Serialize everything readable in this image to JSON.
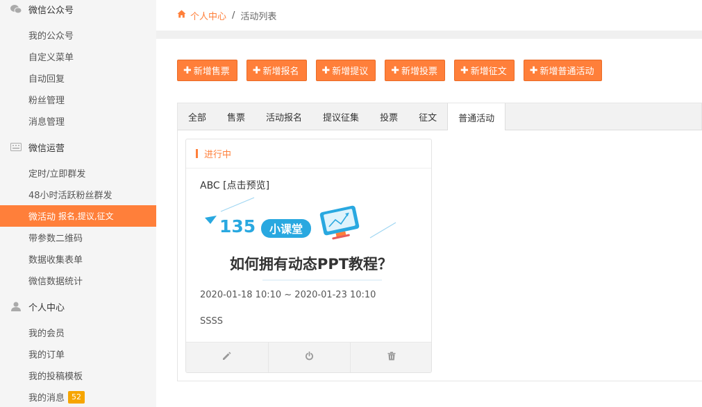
{
  "sidebar": {
    "groups": [
      {
        "title": "微信公众号",
        "icon": "wechat-icon",
        "items": [
          {
            "label": "我的公众号"
          },
          {
            "label": "自定义菜单"
          },
          {
            "label": "自动回复"
          },
          {
            "label": "粉丝管理"
          },
          {
            "label": "消息管理"
          }
        ]
      },
      {
        "title": "微信运营",
        "icon": "keyboard-icon",
        "items": [
          {
            "label": "定时/立即群发"
          },
          {
            "label": "48小时活跃粉丝群发"
          },
          {
            "label": "微活动",
            "sub": "报名,提议,征文",
            "active": true
          },
          {
            "label": "带参数二维码"
          },
          {
            "label": "数据收集表单"
          },
          {
            "label": "微信数据统计"
          }
        ]
      },
      {
        "title": "个人中心",
        "icon": "user-icon",
        "items": [
          {
            "label": "我的会员"
          },
          {
            "label": "我的订单"
          },
          {
            "label": "我的投稿模板"
          },
          {
            "label": "我的消息",
            "badge": "52"
          }
        ]
      }
    ]
  },
  "breadcrumb": {
    "home_label": "个人中心",
    "separator": "/",
    "current": "活动列表"
  },
  "actions": [
    "新增售票",
    "新增报名",
    "新增提议",
    "新增投票",
    "新增征文",
    "新增普通活动"
  ],
  "tabs": [
    {
      "label": "全部"
    },
    {
      "label": "售票"
    },
    {
      "label": "活动报名"
    },
    {
      "label": "提议征集"
    },
    {
      "label": "投票"
    },
    {
      "label": "征文"
    },
    {
      "label": "普通活动",
      "active": true
    }
  ],
  "card": {
    "status": "进行中",
    "title": "ABC [点击预览]",
    "cover": {
      "brand_num": "135",
      "brand_text": "小课堂",
      "headline": "如何拥有动态PPT教程？"
    },
    "date_range": "2020-01-18 10:10 ~ 2020-01-23 10:10",
    "description": "SSSS",
    "actions": [
      "pencil-icon",
      "power-icon",
      "trash-icon"
    ]
  },
  "colors": {
    "accent": "#ff7f3a",
    "badge": "#f6a500",
    "cover_blue": "#29a8e0"
  }
}
